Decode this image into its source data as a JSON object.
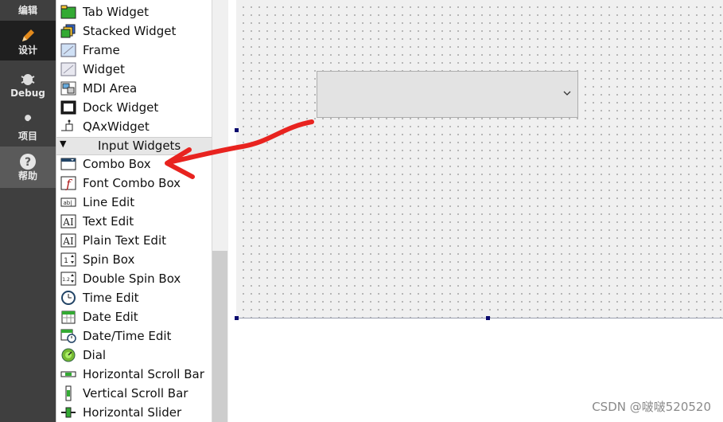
{
  "modes": [
    {
      "id": "edit",
      "label": "编辑",
      "icon": "edit-mode-icon"
    },
    {
      "id": "design",
      "label": "设计",
      "icon": "pencil-icon",
      "active": true
    },
    {
      "id": "debug",
      "label": "Debug",
      "icon": "bug-icon"
    },
    {
      "id": "projects",
      "label": "项目",
      "icon": "wrench-icon"
    },
    {
      "id": "help",
      "label": "帮助",
      "icon": "question-icon"
    }
  ],
  "widget_box": {
    "containers": [
      "Tab Widget",
      "Stacked Widget",
      "Frame",
      "Widget",
      "MDI Area",
      "Dock Widget",
      "QAxWidget"
    ],
    "category": "Input Widgets",
    "inputs": [
      "Combo Box",
      "Font Combo Box",
      "Line Edit",
      "Text Edit",
      "Plain Text Edit",
      "Spin Box",
      "Double Spin Box",
      "Time Edit",
      "Date Edit",
      "Date/Time Edit",
      "Dial",
      "Horizontal Scroll Bar",
      "Vertical Scroll Bar",
      "Horizontal Slider"
    ]
  },
  "form": {
    "combo_value": ""
  },
  "annotation": {
    "color": "#e8231f"
  },
  "watermark": "CSDN @啵啵520520"
}
